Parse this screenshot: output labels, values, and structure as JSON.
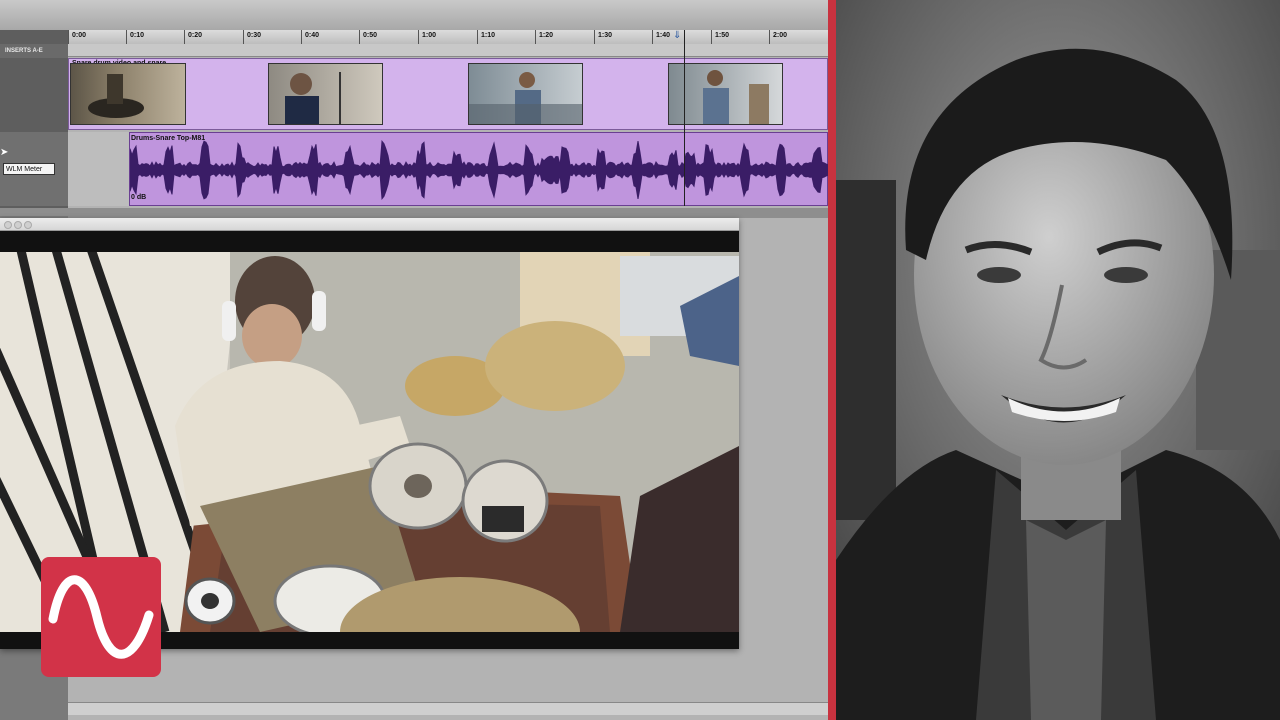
{
  "ruler": {
    "ticks": [
      "0:00",
      "0:10",
      "0:20",
      "0:30",
      "0:40",
      "0:50",
      "1:00",
      "1:10",
      "1:20",
      "1:30",
      "1:40",
      "1:50",
      "2:00"
    ]
  },
  "tracks": {
    "inserts_label": "INSERTS A-E",
    "video_clip_name": "Snare drum video and snare",
    "audio_clip_name": "Drums-Snare Top-M81",
    "audio_gain": "0 dB",
    "plugin_label": "WLM Meter"
  },
  "colors": {
    "video_track": "#d3b3ec",
    "audio_track": "#bf95dd",
    "waveform": "#3a1d66",
    "accent_red": "#c8323f",
    "logo_red": "#d23348"
  },
  "icons": {
    "playhead": "playhead-marker-icon",
    "logo": "sine-wave-logo-icon",
    "cursor": "mouse-cursor-icon"
  }
}
